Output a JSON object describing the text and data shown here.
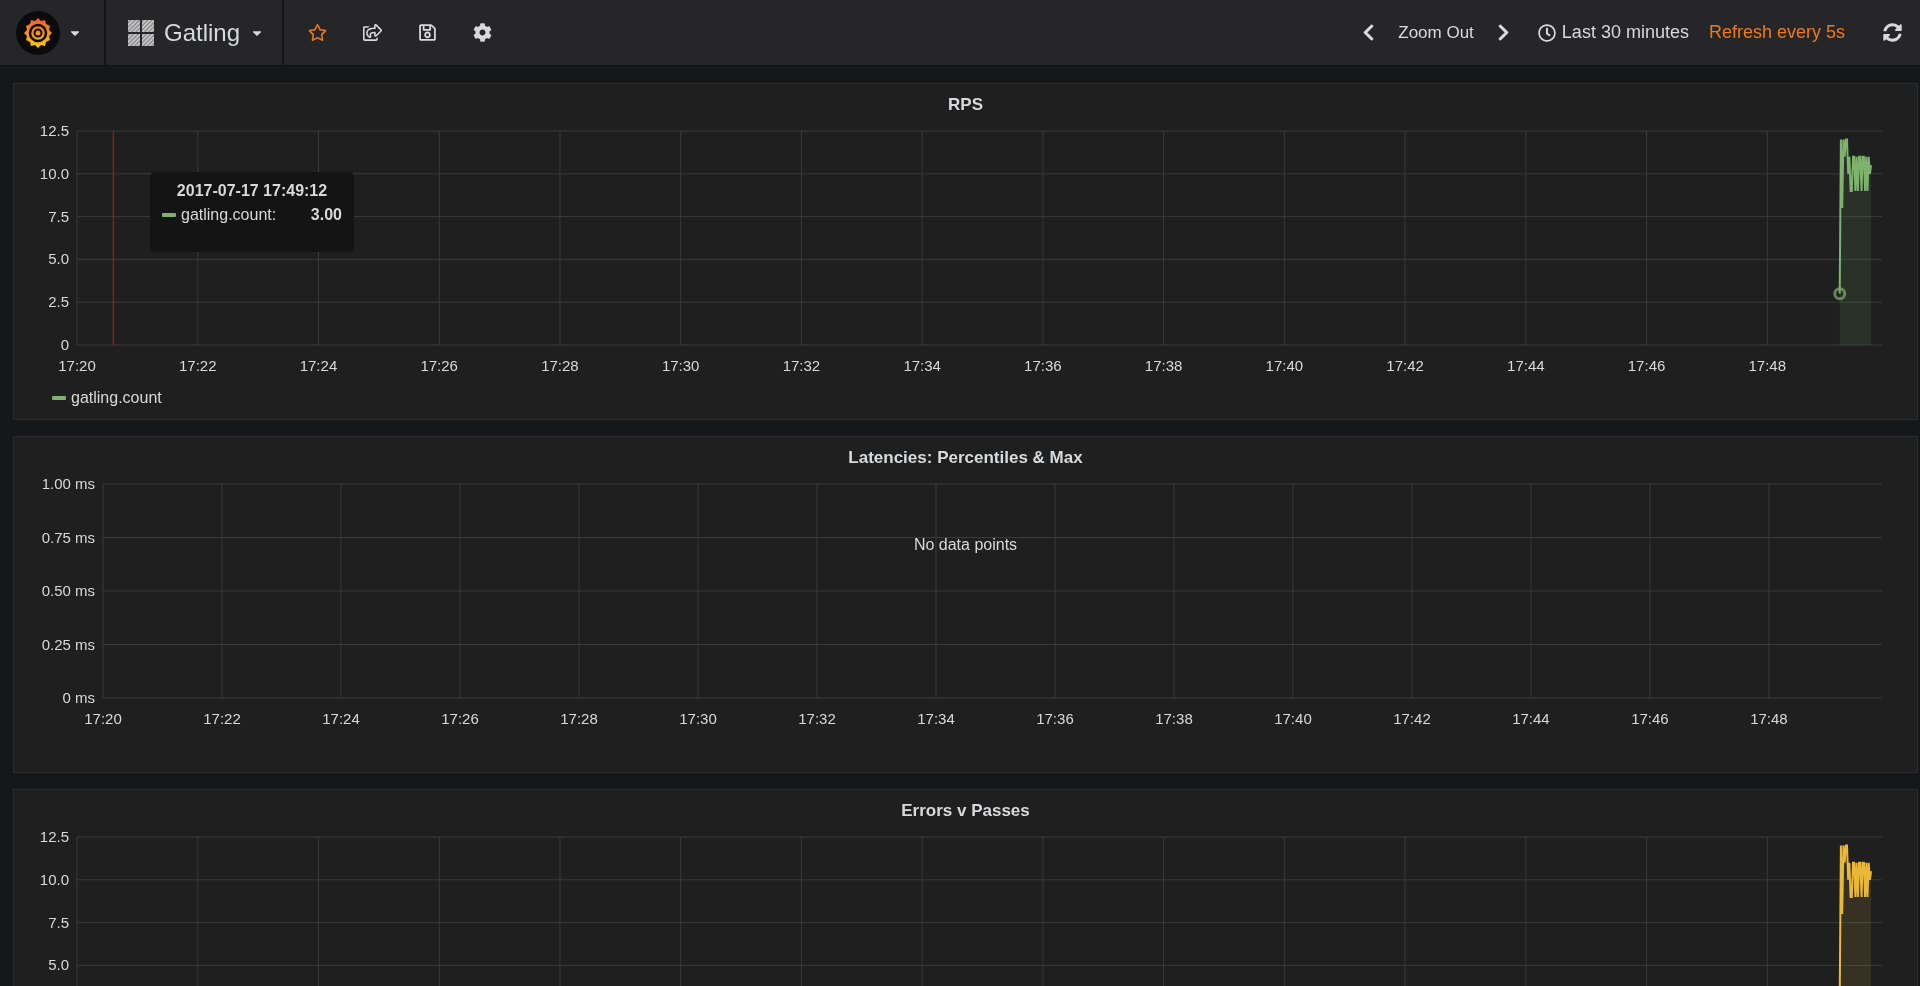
{
  "navbar": {
    "dashboard_title": "Gatling",
    "time_controls": {
      "zoom": "Zoom Out",
      "range": "Last 30 minutes",
      "refresh": "Refresh every 5s"
    }
  },
  "panels": [
    {
      "title": "RPS",
      "color": "#7eb26d",
      "y_axis_labels": [
        "12.5",
        "10.0",
        "7.5",
        "5.0",
        "2.5",
        "0"
      ],
      "x_axis_labels": [
        "17:20",
        "17:22",
        "17:24",
        "17:26",
        "17:28",
        "17:30",
        "17:32",
        "17:34",
        "17:36",
        "17:38",
        "17:40",
        "17:42",
        "17:44",
        "17:46",
        "17:48"
      ],
      "tooltip": {
        "time": "2017-07-17 17:49:12",
        "label": "gatling.count:",
        "value": "3.00"
      },
      "legend": [
        {
          "label": "gatling.count"
        }
      ]
    },
    {
      "title": "Latencies: Percentiles & Max",
      "y_axis_labels": [
        "1.00 ms",
        "0.75 ms",
        "0.50 ms",
        "0.25 ms",
        "0 ms"
      ],
      "x_axis_labels": [
        "17:20",
        "17:22",
        "17:24",
        "17:26",
        "17:28",
        "17:30",
        "17:32",
        "17:34",
        "17:36",
        "17:38",
        "17:40",
        "17:42",
        "17:44",
        "17:46",
        "17:48"
      ],
      "message": "No data points"
    },
    {
      "title": "Errors v Passes",
      "color": "#eab839",
      "y_axis_labels": [
        "12.5",
        "10.0",
        "7.5",
        "5.0"
      ]
    }
  ]
}
